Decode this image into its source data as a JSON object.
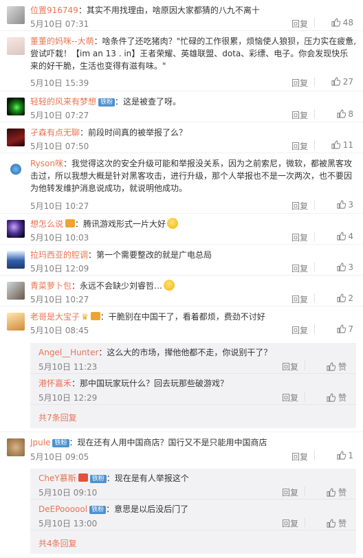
{
  "labels": {
    "reply": "回复",
    "zan": "赞"
  },
  "colors": {
    "username": "#eb7350",
    "meta": "#808080",
    "badge": "#4d91d1",
    "sub_bg": "#f2f2f5"
  },
  "comments": [
    {
      "user": "位置916749",
      "text": "：其实不用找理由，啥原因大家都猜的八九不离十",
      "time": "5月10日 07:31",
      "likes": "48",
      "avatar": "building-avatar"
    },
    {
      "user": "董董的妈咪--大萌",
      "text": "：啥条件了还吃猪肉？\"忙碌的工作很累，烦恼使人狼狈，压力实在疲惫,尝试吓栽！【im an 13 . in】王者荣耀、英雄联盟、dota、彩缥、电子。你会发现快乐来的好干脆，生活也变得有滋有味。\"",
      "time": "5月10日 15:39",
      "likes": "27",
      "avatar": "anime-avatar"
    },
    {
      "user": "轻轻的风来有梦想",
      "badge": "铁粉",
      "text": "：这是被查了呀。",
      "time": "5月10日 07:27",
      "likes": "8",
      "avatar": "green-light-avatar"
    },
    {
      "user": "孑森有点无聊",
      "text": "：前段时间真的被举报了么？",
      "time": "5月10日 07:50",
      "likes": "11",
      "avatar": "dark-red-avatar"
    },
    {
      "user": "Ryson咪",
      "text": "：我觉得这次的安全升级可能和举报没关系，因为之前索尼，微软，都被黑客攻击过，所以我想大概是针对黑客攻击，进行升级，那个人举报也不是一次两次，也不要因为他转发维护消息说成功，就说明他成功。",
      "time": "5月10日 10:27",
      "likes": "3",
      "avatar": "cat-avatar"
    },
    {
      "user": "想怎么说",
      "text": "：腾讯游戏形式一片大好",
      "time": "5月10日 10:03",
      "likes": "4",
      "avatar": "galaxy-avatar",
      "vip": true,
      "emoji": true
    },
    {
      "user": "拉玛西亚的腔调",
      "text": "：第一个需要整改的就是广电总局",
      "time": "5月10日 12:09",
      "likes": "3",
      "avatar": "pixel-avatar"
    },
    {
      "user": "青菜萝卜包",
      "text": "：永远不会缺少刘睿哲…",
      "time": "5月10日 10:27",
      "likes": "2",
      "avatar": "room-avatar",
      "emoji": true
    },
    {
      "user": "老哥是大宝子",
      "text": "：干脆别在中国干了，看着都烦，费劲不讨好",
      "time": "5月10日 08:45",
      "likes": "7",
      "avatar": "cartoon-avatar",
      "crown": true,
      "vip": true,
      "replies": [
        {
          "user": "Angel__Hunter",
          "text": "：这么大的市场，撵他他都不走，你说别干了？",
          "time": "5月10日 11:23"
        },
        {
          "user": "港怀嘉禾",
          "text": "：那中国玩家玩什么？回去玩那些破游戏？",
          "time": "5月10日 12:29"
        }
      ],
      "more": "共7条回复"
    },
    {
      "user": "Jpule",
      "badge": "铁粉",
      "text": "：现在还有人用中国商店？国行又不是只能用中国商店",
      "time": "5月10日 09:05",
      "likes": "1",
      "avatar": "cat-photo-avatar",
      "replies": [
        {
          "user": "CheY慕斯",
          "vipred": true,
          "badge": "铁粉",
          "text": "：现在是有人举报这个",
          "time": "5月10日 09:10"
        },
        {
          "user": "DeEPoooool",
          "badge": "铁粉",
          "text": "：意思是以后没后门了",
          "time": "5月10日 13:00"
        }
      ],
      "more": "共4条回复"
    }
  ]
}
